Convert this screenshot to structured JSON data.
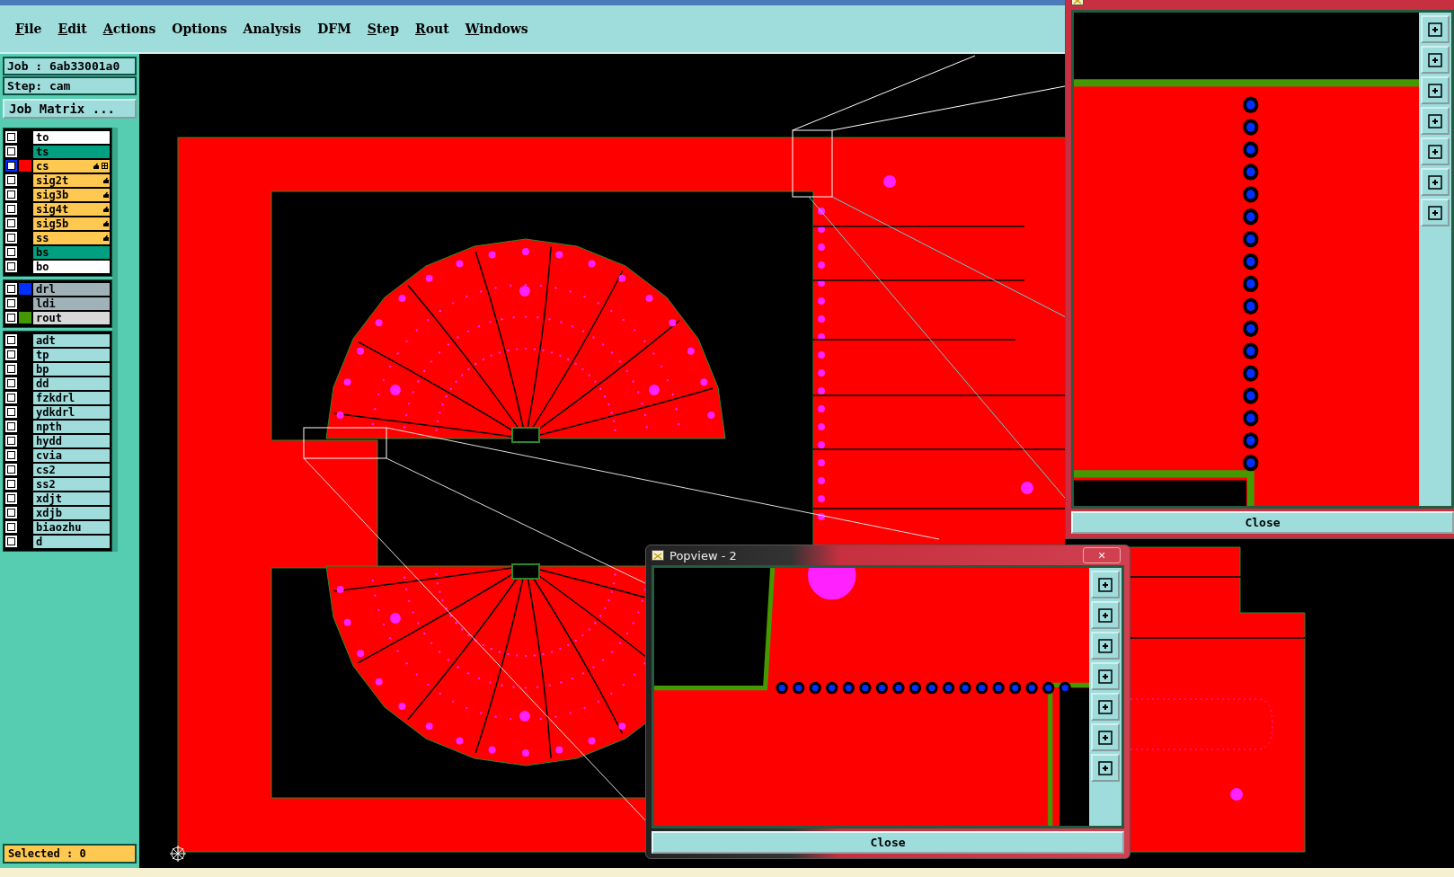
{
  "menu": [
    {
      "label": "File",
      "mnemonic": true
    },
    {
      "label": "Edit",
      "mnemonic": true
    },
    {
      "label": "Actions",
      "mnemonic": true
    },
    {
      "label": "Options",
      "mnemonic": false
    },
    {
      "label": "Analysis",
      "mnemonic": false
    },
    {
      "label": "DFM",
      "mnemonic": false
    },
    {
      "label": "Step",
      "mnemonic": true
    },
    {
      "label": "Rout",
      "mnemonic": true
    },
    {
      "label": "Windows",
      "mnemonic": true
    }
  ],
  "job": "Job : 6ab33001a0",
  "step": "Step: cam",
  "job_matrix_button": "Job Matrix ...",
  "layer_groups": [
    [
      {
        "name": "to",
        "kind": "document",
        "selected": false,
        "affected": false
      },
      {
        "name": "ts",
        "kind": "mask",
        "selected": false,
        "affected": false
      },
      {
        "name": "cs",
        "kind": "signal",
        "color": "#ff0000",
        "selected": true,
        "affected": true
      },
      {
        "name": "sig2t",
        "kind": "signal",
        "selected": false,
        "affected": true
      },
      {
        "name": "sig3b",
        "kind": "signal",
        "selected": false,
        "affected": true
      },
      {
        "name": "sig4t",
        "kind": "signal",
        "selected": false,
        "affected": true
      },
      {
        "name": "sig5b",
        "kind": "signal",
        "selected": false,
        "affected": true
      },
      {
        "name": "ss",
        "kind": "signal",
        "selected": false,
        "affected": true
      },
      {
        "name": "bs",
        "kind": "mask",
        "selected": false,
        "affected": false
      },
      {
        "name": "bo",
        "kind": "document",
        "selected": false,
        "affected": false
      }
    ],
    [
      {
        "name": "drl",
        "kind": "drill",
        "color": "#0030ff",
        "selected": false,
        "affected": false
      },
      {
        "name": "ldi",
        "kind": "drill",
        "selected": false,
        "affected": false
      },
      {
        "name": "rout",
        "kind": "rout",
        "color": "#449900",
        "selected": false,
        "affected": false
      }
    ],
    [
      {
        "name": "adt",
        "kind": "misc",
        "selected": false,
        "affected": false
      },
      {
        "name": "tp",
        "kind": "misc",
        "selected": false,
        "affected": false
      },
      {
        "name": "bp",
        "kind": "misc",
        "selected": false,
        "affected": false
      },
      {
        "name": "dd",
        "kind": "misc",
        "selected": false,
        "affected": false
      },
      {
        "name": "fzkdrl",
        "kind": "misc",
        "selected": false,
        "affected": false
      },
      {
        "name": "ydkdrl",
        "kind": "misc",
        "selected": false,
        "affected": false
      },
      {
        "name": "npth",
        "kind": "misc",
        "selected": false,
        "affected": false
      },
      {
        "name": "hydd",
        "kind": "misc",
        "selected": false,
        "affected": false
      },
      {
        "name": "cvia",
        "kind": "misc",
        "selected": false,
        "affected": false
      },
      {
        "name": "cs2",
        "kind": "misc",
        "selected": false,
        "affected": false
      },
      {
        "name": "ss2",
        "kind": "misc",
        "selected": false,
        "affected": false
      },
      {
        "name": "xdjt",
        "kind": "misc",
        "selected": false,
        "affected": false
      },
      {
        "name": "xdjb",
        "kind": "misc",
        "selected": false,
        "affected": false
      },
      {
        "name": "biaozhu",
        "kind": "misc",
        "selected": false,
        "affected": false
      },
      {
        "name": "d",
        "kind": "misc",
        "selected": false,
        "affected": false
      }
    ]
  ],
  "selected_count": "Selected : 0",
  "popviews": [
    {
      "kind": "vertical",
      "close": "Close"
    },
    {
      "kind": "horizontal",
      "title": "Popview - 2",
      "close_glyph": "×",
      "close": "Close"
    }
  ]
}
